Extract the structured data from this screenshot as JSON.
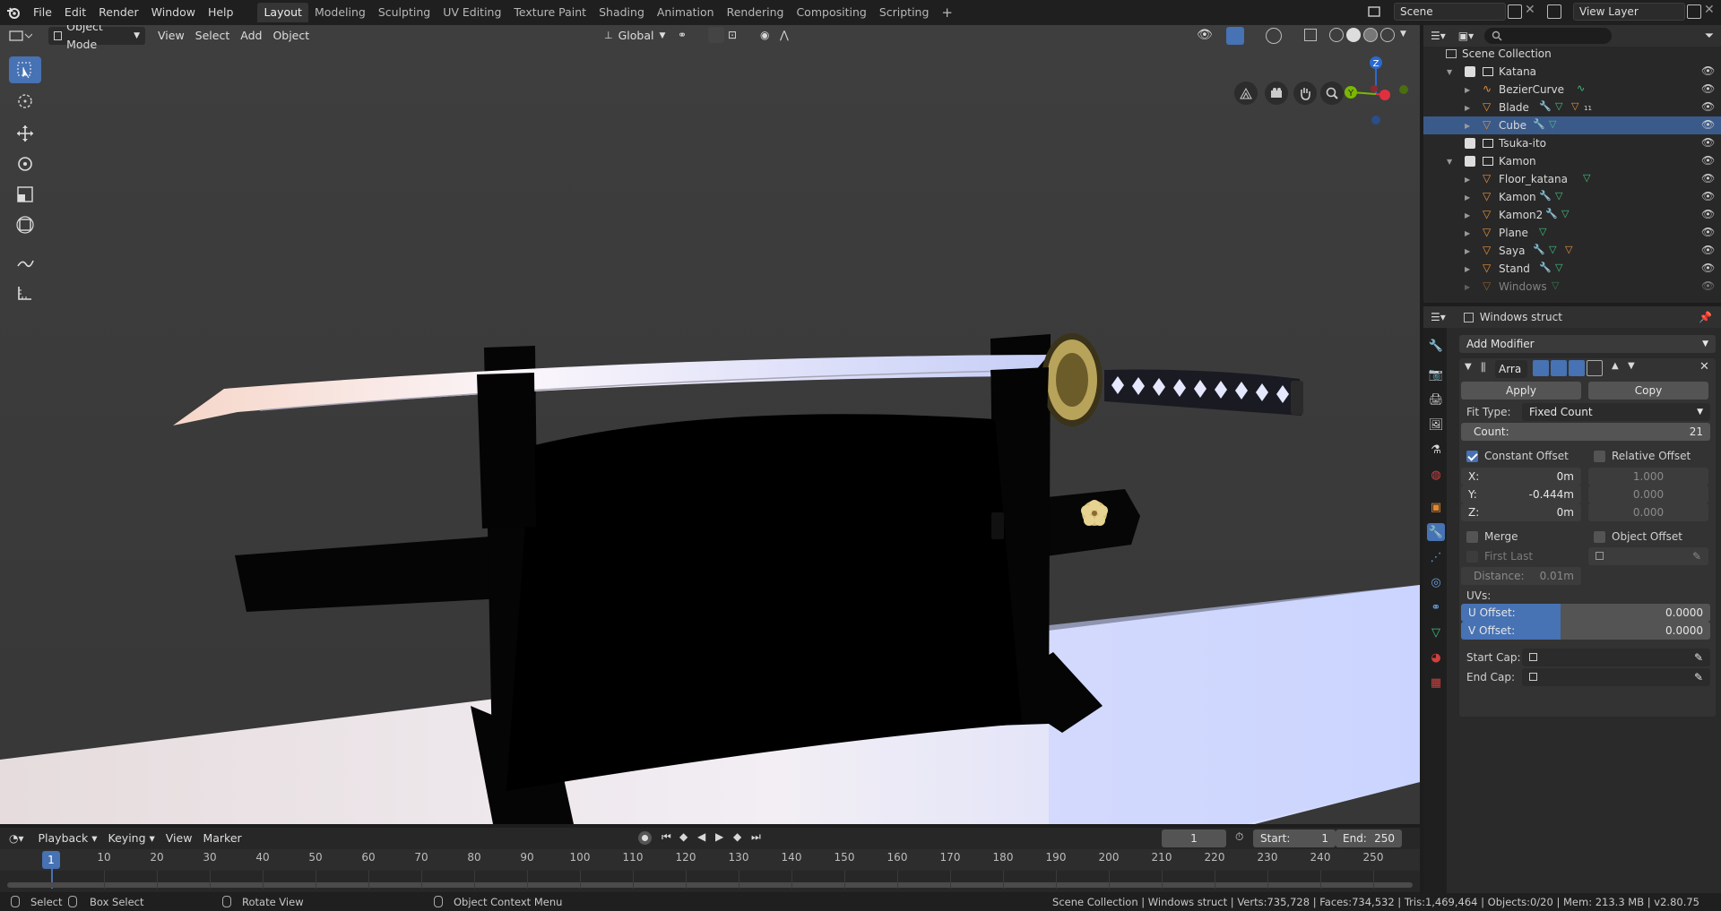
{
  "menubar": {
    "file": "File",
    "edit": "Edit",
    "render": "Render",
    "window": "Window",
    "help": "Help"
  },
  "workspaces": [
    "Layout",
    "Modeling",
    "Sculpting",
    "UV Editing",
    "Texture Paint",
    "Shading",
    "Animation",
    "Rendering",
    "Compositing",
    "Scripting"
  ],
  "active_workspace": "Layout",
  "scene_name": "Scene",
  "view_layer": "View Layer",
  "viewport_header": {
    "mode": "Object Mode",
    "view": "View",
    "select": "Select",
    "add": "Add",
    "object": "Object",
    "orientation": "Global"
  },
  "gizmo": {
    "z": "Z",
    "y": "Y"
  },
  "outliner": {
    "root": "Scene Collection",
    "rows": [
      {
        "name": "Katana",
        "kind": "collection"
      },
      {
        "name": "BezierCurve",
        "kind": "curve"
      },
      {
        "name": "Blade",
        "kind": "mesh"
      },
      {
        "name": "Cube",
        "kind": "mesh",
        "selected": true
      },
      {
        "name": "Tsuka-ito",
        "kind": "collection"
      },
      {
        "name": "Kamon",
        "kind": "collection"
      },
      {
        "name": "Floor_katana",
        "kind": "mesh"
      },
      {
        "name": "Kamon",
        "kind": "mesh"
      },
      {
        "name": "Kamon2",
        "kind": "mesh"
      },
      {
        "name": "Plane",
        "kind": "mesh"
      },
      {
        "name": "Saya",
        "kind": "mesh"
      },
      {
        "name": "Stand",
        "kind": "mesh"
      },
      {
        "name": "Windows",
        "kind": "mesh"
      }
    ],
    "blade_badge": "11"
  },
  "properties": {
    "object_name": "Windows struct",
    "add_modifier": "Add Modifier",
    "modifier_name": "Arra",
    "apply": "Apply",
    "copy": "Copy",
    "fit_type_label": "Fit Type:",
    "fit_type_value": "Fixed Count",
    "count_label": "Count:",
    "count_value": "21",
    "constant_offset": "Constant Offset",
    "relative_offset": "Relative Offset",
    "const": {
      "x_label": "X:",
      "x": "0m",
      "y_label": "Y:",
      "y": "-0.444m",
      "z_label": "Z:",
      "z": "0m"
    },
    "rel": {
      "x": "1.000",
      "y": "0.000",
      "z": "0.000"
    },
    "merge": "Merge",
    "object_offset": "Object Offset",
    "first_last": "First Last",
    "distance_label": "Distance:",
    "distance_value": "0.01m",
    "uvs": "UVs:",
    "u_offset_label": "U Offset:",
    "u_offset_value": "0.0000",
    "v_offset_label": "V Offset:",
    "v_offset_value": "0.0000",
    "start_cap": "Start Cap:",
    "end_cap": "End Cap:"
  },
  "timeline": {
    "playback": "Playback",
    "keying": "Keying",
    "view": "View",
    "marker": "Marker",
    "current_frame": "1",
    "start_label": "Start:",
    "start": "1",
    "end_label": "End:",
    "end": "250",
    "ticks": [
      "10",
      "20",
      "30",
      "40",
      "50",
      "60",
      "70",
      "80",
      "90",
      "100",
      "110",
      "120",
      "130",
      "140",
      "150",
      "160",
      "170",
      "180",
      "190",
      "200",
      "210",
      "220",
      "230",
      "240",
      "250"
    ]
  },
  "statusbar": {
    "select": "Select",
    "box_select": "Box Select",
    "rotate_view": "Rotate View",
    "context_menu": "Object Context Menu",
    "info": "Scene Collection | Windows struct | Verts:735,728 | Faces:734,532 | Tris:1,469,464 | Objects:0/20 | Mem: 213.3 MB | v2.80.75"
  }
}
